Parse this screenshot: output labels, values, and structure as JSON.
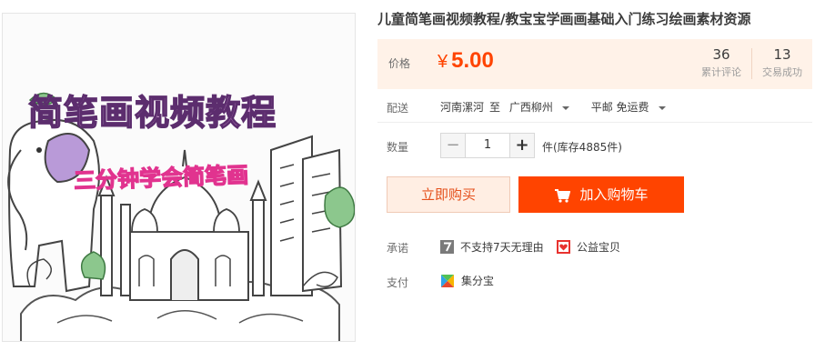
{
  "product_image": {
    "title_chars": [
      "简",
      "笔",
      "画",
      "视",
      "频",
      "教",
      "程"
    ],
    "subtitle": "三分钟学会简笔画"
  },
  "title": "儿童简笔画视频教程/教宝宝学画画基础入门练习绘画素材资源",
  "price": {
    "label": "价格",
    "currency": "¥",
    "value": "5.00",
    "reviews_count": "36",
    "reviews_label": "累计评论",
    "trades_count": "13",
    "trades_label": "交易成功"
  },
  "delivery": {
    "label": "配送",
    "from": "河南漯河",
    "to_word": "至",
    "destination": "广西柳州",
    "shipping": "平邮 免运费"
  },
  "quantity": {
    "label": "数量",
    "minus": "−",
    "value": "1",
    "plus": "+",
    "stock": "件(库存4885件)"
  },
  "actions": {
    "buy_now": "立即购买",
    "add_to_cart": "加入购物车"
  },
  "promise": {
    "label": "承诺",
    "items": [
      "不支持7天无理由",
      "公益宝贝"
    ]
  },
  "payment": {
    "label": "支付",
    "method": "集分宝"
  },
  "colors": {
    "accent": "#ff4400",
    "price_bg": "#fff2e8",
    "buy_now_bg": "#ffeee3"
  }
}
